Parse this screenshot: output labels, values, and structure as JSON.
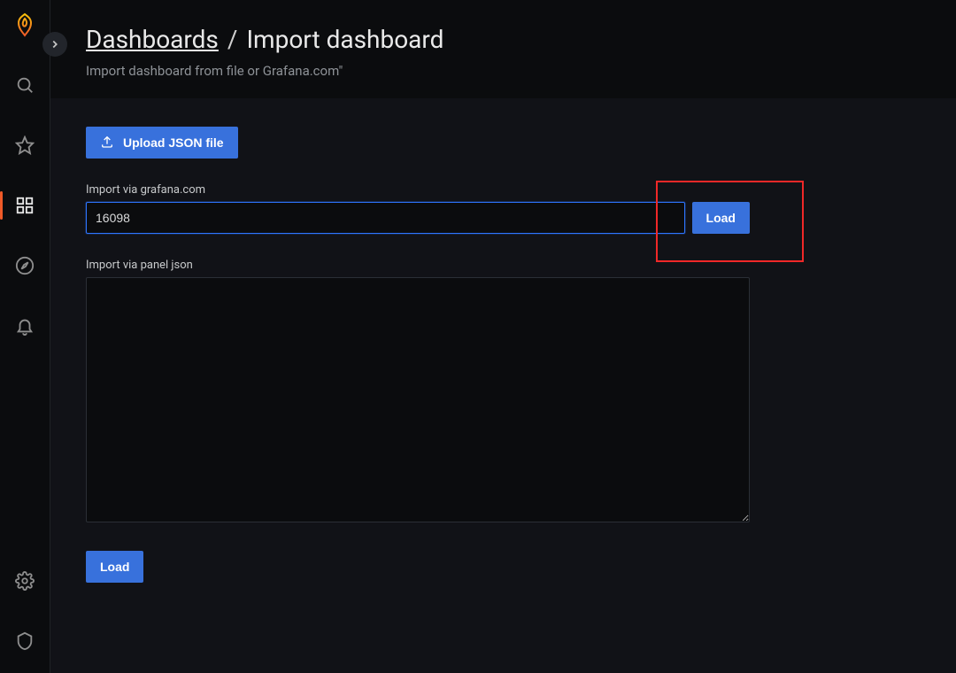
{
  "breadcrumb": {
    "root": "Dashboards",
    "separator": "/",
    "current": "Import dashboard"
  },
  "subtitle": "Import dashboard from file or Grafana.com\"",
  "buttons": {
    "upload": "Upload JSON file",
    "load_inline": "Load",
    "load_bottom": "Load"
  },
  "fields": {
    "grafana_label": "Import via grafana.com",
    "grafana_value": "16098",
    "json_label": "Import via panel json",
    "json_value": ""
  }
}
